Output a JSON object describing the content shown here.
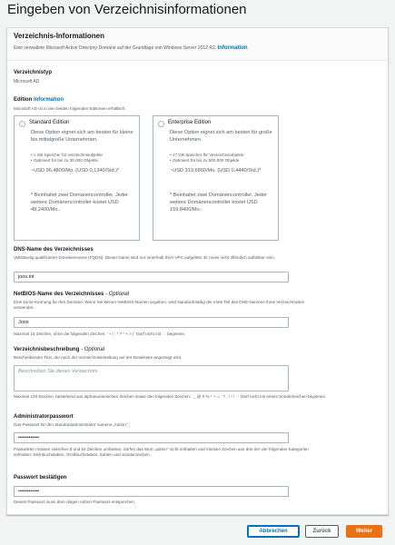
{
  "page": {
    "title": "Eingeben von Verzeichnisinformationen"
  },
  "panel": {
    "title": "Verzeichnis-Informationen",
    "description": "Eine verwaltete Microsoft Active Directory-Domäne auf der Grundlage von Windows Server 2012 R2.",
    "info_label": "Information"
  },
  "directory_type": {
    "label": "Verzeichnistyp",
    "value": "Microsoft AD"
  },
  "edition": {
    "label": "Edition",
    "info_label": "Information",
    "description": "Microsoft AD ist in den beiden folgenden Editionen erhältlich:",
    "options": [
      {
        "name": "Standard Edition",
        "description": "Diese Option eignet sich am besten für kleine bis mittelgroße Unternehmen.",
        "features": [
          "1 GB Speicher für Verzeichnisobjekte",
          "Optimiert für bis zu 30.000 Objekte"
        ],
        "price": "~USD 96,4800/Mo. (USD 0,1340/Std.)*",
        "note": "* Beinhaltet zwei Domänencontroller. Jeder weitere Domänencontroller kostet USD 48,2400/Mo.."
      },
      {
        "name": "Enterprise Edition",
        "description": "Diese Option eignet sich am besten für große Unternehmen.",
        "features": [
          "17 GB Speicher für Verzeichnisobjekte",
          "Optimiert für bis zu 500.000 Objekte"
        ],
        "price": "~USD 319,6800/Mo. (USD 0,4440/Std.)*",
        "note": "* Beinhaltet zwei Domänencontroller. Jeder weitere Domänencontroller kostet USD 159,8400/Mo.."
      }
    ]
  },
  "dns": {
    "label": "DNS-Name des Verzeichnisses",
    "help": "Vollständig qualifizierter Domänenname (FQDN). Dieser Name wird nur innerhalb Ihrer VPC aufgelöst. Er muss nicht öffentlich auflösbar sein.",
    "value": "joos.int"
  },
  "netbios": {
    "label": "NetBIOS-Name des Verzeichnisses",
    "optional": "- Optional",
    "help": "Eine kurze Kennung für Ihre Domäne. Wenn Sie keinen NetBIOS-Namen angeben, wird standardmäßig der erste Teil des DNS-Namens Ihres Verzeichnisses verwendet.",
    "value": "Joos",
    "constraint": "Maximal 15 Zeichen, ohne die folgenden Zeichen: `~ / : * ? \" < > |` Darf nicht mit `.` beginnen."
  },
  "description_field": {
    "label": "Verzeichnisbeschreibung",
    "optional": "- Optional",
    "help": "Beschreibender Text, der nach der Verzeichniserstellung auf der Detailseite angezeigt wird.",
    "placeholder": "Beschreiben Sie dieses Verzeichnis.",
    "constraint": "Maximal 128 Zeichen, bestehend aus alphanumerischen Zeichen sowie den folgenden Zeichen: `_ @ # % * + = : ? . / ! \\ - ` Darf nicht mit einem Sonderzeichen beginnen."
  },
  "admin_password": {
    "label": "Administratorpasswort",
    "help": "Das Passwort für den Standardadministrator namens „Admin\".",
    "value": "••••••••••••",
    "constraint": "Passwörter müssen zwischen 8 und 64 Zeichen umfassen, dürfen das Wort „admin\" nicht enthalten und müssen Zeichen aus drei der vier folgenden Kategorien enthalten: Kleinbuchstaben, Großbuchstaben, Zahlen und Sonderzeichen."
  },
  "confirm_password": {
    "label": "Passwort bestätigen",
    "value": "••••••••••••",
    "constraint": "Dieses Passwort muss dem obigen Admin-Passwort entsprechen."
  },
  "buttons": {
    "cancel": "Abbrechen",
    "back": "Zurück",
    "next": "Weiter"
  },
  "colors": {
    "primary": "#ec7211",
    "link": "#0073bb",
    "background": "#f2f3f3"
  }
}
